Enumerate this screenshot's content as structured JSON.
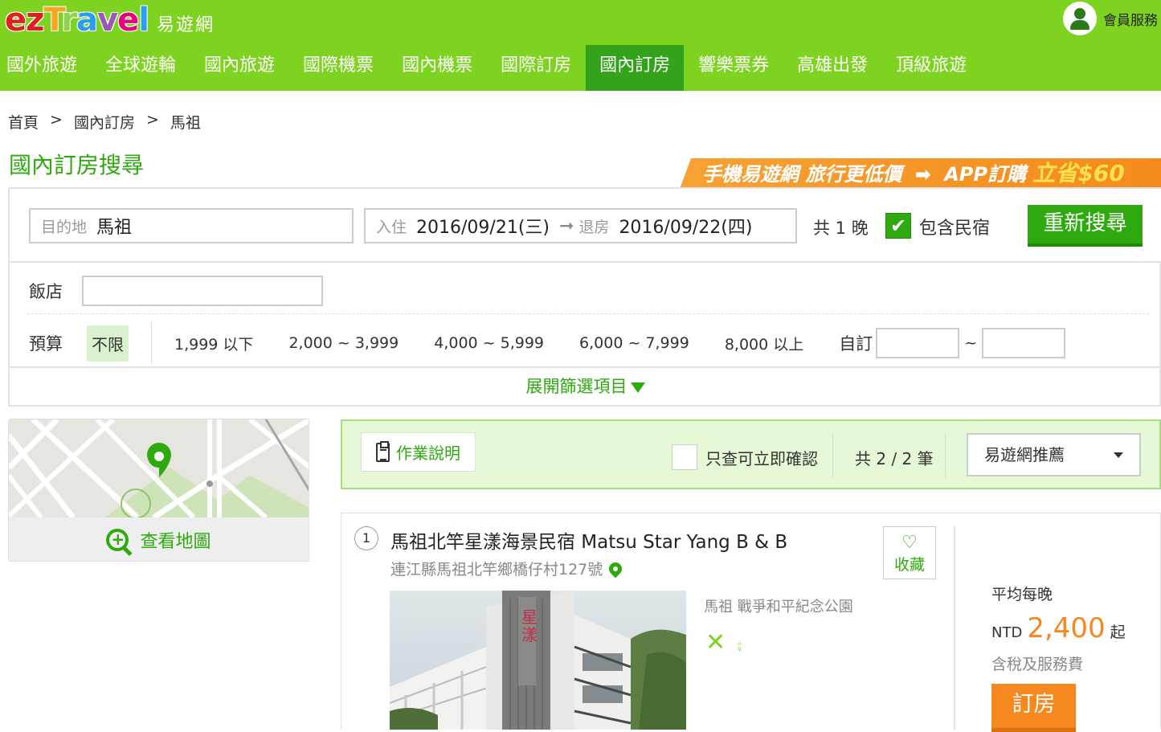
{
  "header": {
    "logo_word": [
      "e",
      "z",
      "T",
      "r",
      "a",
      "v",
      "e",
      "l"
    ],
    "logo_cn": "易遊網",
    "member_label": "會員服務",
    "nav": [
      {
        "label": "國外旅遊",
        "active": false
      },
      {
        "label": "全球遊輪",
        "active": false
      },
      {
        "label": "國內旅遊",
        "active": false
      },
      {
        "label": "國際機票",
        "active": false
      },
      {
        "label": "國內機票",
        "active": false
      },
      {
        "label": "國際訂房",
        "active": false
      },
      {
        "label": "國內訂房",
        "active": true
      },
      {
        "label": "響樂票券",
        "active": false
      },
      {
        "label": "高雄出發",
        "active": false
      },
      {
        "label": "頂級旅遊",
        "active": false
      }
    ]
  },
  "breadcrumb": {
    "home": "首頁",
    "sep": ">",
    "level1": "國內訂房",
    "level2": "馬祖"
  },
  "page_title": "國內訂房搜尋",
  "promo": {
    "text1": "手機易遊網 旅行更低價",
    "text2": "APP訂購",
    "highlight": "立省$60"
  },
  "search": {
    "dest_label": "目的地",
    "dest_value": "馬祖",
    "checkin_label": "入住",
    "checkin_value": "2016/09/21(三)",
    "checkout_label": "退房",
    "checkout_value": "2016/09/22(四)",
    "nights_text": "共 1 晚",
    "include_bnb_checked": true,
    "include_bnb_label": "包含民宿",
    "search_button": "重新搜尋"
  },
  "filters": {
    "hotel_label": "飯店",
    "hotel_value": "",
    "budget_label": "預算",
    "budget_selected": "不限",
    "budget_options": [
      "1,999 以下",
      "2,000 ~ 3,999",
      "4,000 ~ 5,999",
      "6,000 ~ 7,999",
      "8,000 以上"
    ],
    "custom_label": "自訂",
    "custom_sep": "~",
    "expand_label": "展開篩選項目"
  },
  "map": {
    "button_label": "查看地圖"
  },
  "results_bar": {
    "guide_label": "作業說明",
    "instant_confirm_label": "只查可立即確認",
    "count_text": "共 2 / 2 筆",
    "sort_selected": "易遊網推薦"
  },
  "results": [
    {
      "index": "1",
      "name": "馬祖北竿星漾海景民宿 Matsu Star Yang B & B",
      "address": "連江縣馬祖北竿鄉橋仔村127號",
      "nearby": "馬祖 戰爭和平紀念公園",
      "favorite_label": "收藏",
      "amenities": [
        "dining-icon",
        "wifi-icon"
      ],
      "price_caption": "平均每晚",
      "currency": "NTD",
      "price": "2,400",
      "price_suffix": "起",
      "tax_note": "含稅及服務費",
      "book_label": "訂房"
    }
  ],
  "colors": {
    "brand_green": "#7ed321",
    "active_green": "#35a21c",
    "accent_green": "#2eaa0e",
    "price_orange": "#f5891f"
  }
}
